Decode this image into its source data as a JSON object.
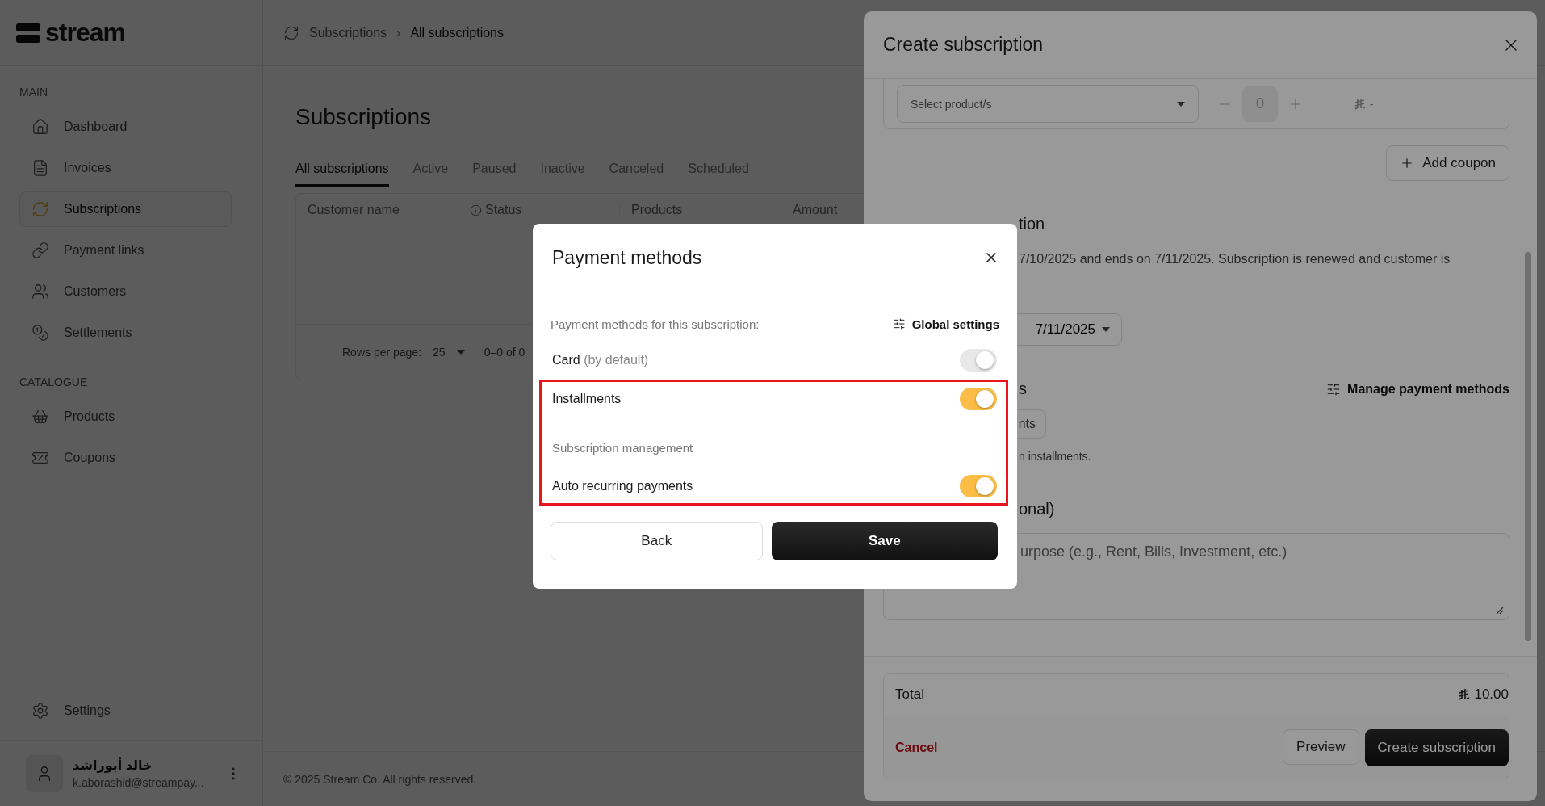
{
  "sidebar": {
    "logo": "stream",
    "sections": [
      {
        "title": "MAIN",
        "items": [
          {
            "label": "Dashboard",
            "selected": false
          },
          {
            "label": "Invoices",
            "selected": false
          },
          {
            "label": "Subscriptions",
            "selected": true
          },
          {
            "label": "Payment links",
            "selected": false
          },
          {
            "label": "Customers",
            "selected": false
          },
          {
            "label": "Settlements",
            "selected": false
          }
        ]
      },
      {
        "title": "CATALOGUE",
        "items": [
          {
            "label": "Products",
            "selected": false
          },
          {
            "label": "Coupons",
            "selected": false
          }
        ]
      }
    ],
    "settings": "Settings",
    "user": {
      "name": "خالد أبوراشد",
      "email": "k.aborashid@streampay..."
    }
  },
  "breadcrumb": [
    "Subscriptions",
    "All subscriptions"
  ],
  "breadcrumb_separator": "›",
  "page": {
    "title": "Subscriptions",
    "tabs": [
      {
        "label": "All subscriptions",
        "selected": true
      },
      {
        "label": "Active",
        "selected": false
      },
      {
        "label": "Paused",
        "selected": false
      },
      {
        "label": "Inactive",
        "selected": false
      },
      {
        "label": "Canceled",
        "selected": false
      },
      {
        "label": "Scheduled",
        "selected": false
      }
    ],
    "table": {
      "columns": [
        {
          "label": "Customer name",
          "info": false
        },
        {
          "label": "Status",
          "info": true
        },
        {
          "label": "Products",
          "info": false
        },
        {
          "label": "Amount",
          "info": false
        }
      ],
      "pagination": {
        "rows_label": "Rows per page:",
        "rows_value": "25",
        "range": "0–0 of 0"
      }
    }
  },
  "footer": "© 2025 Stream Co. All rights reserved.",
  "drawer": {
    "title": "Create subscription",
    "product_select": {
      "placeholder": "Select product/s"
    },
    "quantity": "0",
    "unit_price": "-",
    "add_coupon": "Add coupon",
    "duration_heading": "tion",
    "duration_text": "7/10/2025 and ends on 7/11/2025. Subscription is renewed and customer is",
    "end_date": "7/11/2025",
    "methods_heading": "s",
    "manage_methods": "Manage payment methods",
    "method_chip": "nts",
    "methods_note": "n installments.",
    "purpose_heading": "onal)",
    "purpose_field": {
      "placeholder": "urpose (e.g., Rent, Bills, Investment, etc.)"
    },
    "total_label": "Total",
    "total_amount": "10.00",
    "cancel": "Cancel",
    "preview": "Preview",
    "create": "Create subscription"
  },
  "modal": {
    "title": "Payment methods",
    "subtitle": "Payment methods for this subscription:",
    "global_settings": "Global settings",
    "sections": [
      {
        "highlighted": false,
        "rows": [
          {
            "kind": "toggle",
            "label": "Card",
            "note": "(by default)",
            "on": true,
            "disabled": true
          }
        ]
      },
      {
        "highlighted": true,
        "rows": [
          {
            "kind": "toggle",
            "label": "Installments",
            "on": true,
            "disabled": false
          },
          {
            "kind": "heading",
            "label": "Subscription management"
          },
          {
            "kind": "toggle",
            "label": "Auto recurring payments",
            "on": true,
            "disabled": false
          }
        ]
      }
    ],
    "back": "Back",
    "save": "Save"
  }
}
